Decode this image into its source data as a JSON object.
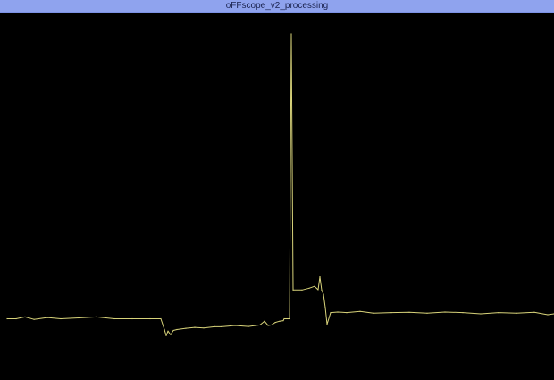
{
  "window": {
    "title": "oFFscope_v2_processing"
  },
  "colors": {
    "titlebar_bg": "#8fa3ee",
    "scope_bg": "#000000",
    "trace": "#d8d37a"
  },
  "chart_data": {
    "type": "line",
    "title": "",
    "xlabel": "",
    "ylabel": "",
    "grid": false,
    "legend": "none",
    "xlim": [
      0,
      612
    ],
    "ylim": [
      -0.2,
      1.0
    ],
    "series": [
      {
        "color": "#d8d37a",
        "x": [
          0,
          10,
          20,
          30,
          45,
          60,
          80,
          100,
          120,
          140,
          160,
          172,
          176,
          178,
          180,
          183,
          186,
          190,
          200,
          210,
          220,
          232,
          240,
          255,
          270,
          283,
          288,
          292,
          296,
          300,
          305,
          309,
          310,
          312,
          314,
          316,
          318,
          320,
          330,
          338,
          344,
          348,
          350,
          352,
          354,
          356,
          358,
          362,
          370,
          380,
          395,
          410,
          430,
          450,
          470,
          490,
          510,
          530,
          550,
          570,
          590,
          605,
          612
        ],
        "y": [
          0.0,
          0.0,
          0.006,
          -0.002,
          0.004,
          0.0,
          0.003,
          0.006,
          0.0,
          0.0,
          0.0,
          0.0,
          -0.035,
          -0.055,
          -0.04,
          -0.052,
          -0.038,
          -0.035,
          -0.031,
          -0.028,
          -0.03,
          -0.026,
          -0.026,
          -0.022,
          -0.025,
          -0.02,
          -0.008,
          -0.022,
          -0.02,
          -0.012,
          -0.008,
          -0.006,
          0.0,
          0.0,
          0.0,
          0.0,
          0.93,
          0.094,
          0.094,
          0.1,
          0.106,
          0.095,
          0.137,
          0.093,
          0.08,
          0.037,
          -0.018,
          0.02,
          0.022,
          0.02,
          0.024,
          0.018,
          0.02,
          0.021,
          0.018,
          0.022,
          0.02,
          0.016,
          0.02,
          0.018,
          0.021,
          0.013,
          0.016
        ]
      }
    ]
  }
}
